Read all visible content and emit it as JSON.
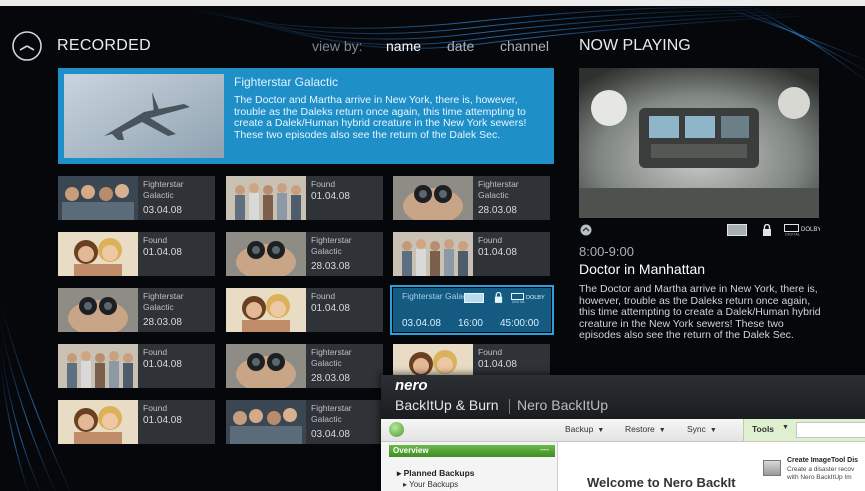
{
  "header": {
    "section_title": "RECORDED",
    "view_by_label": "view by:",
    "view_options": [
      "name",
      "date",
      "channel"
    ],
    "active_view": "name",
    "now_playing_title": "NOW PLAYING"
  },
  "featured": {
    "title": "Fighterstar Galactic",
    "description": "The Doctor and Martha arrive in New York, there is, however, trouble as the Daleks return once again, this time attempting to create a Dalek/Human hybrid creature in the New York sewers! These two episodes also see the return of the Dalek Sec."
  },
  "recordings": [
    {
      "title": "Fighterstar Galactic",
      "date": "03.04.08",
      "thumb": "crowd"
    },
    {
      "title": "Found",
      "date": "01.04.08",
      "thumb": "family"
    },
    {
      "title": "Fighterstar Galactic",
      "date": "28.03.08",
      "thumb": "binoculars"
    },
    {
      "title": "Found",
      "date": "01.04.08",
      "thumb": "couple"
    },
    {
      "title": "Fighterstar Galactic",
      "date": "28.03.08",
      "thumb": "binoculars"
    },
    {
      "title": "Found",
      "date": "01.04.08",
      "thumb": "family"
    },
    {
      "title": "Fighterstar Galactic",
      "date": "28.03.08",
      "thumb": "binoculars"
    },
    {
      "title": "Found",
      "date": "01.04.08",
      "thumb": "couple"
    },
    {
      "title": "Fighterstar Galactic",
      "date": "03.04.08",
      "time": "16:00",
      "duration": "45:00:00",
      "selected": true
    },
    {
      "title": "Found",
      "date": "01.04.08",
      "thumb": "family"
    },
    {
      "title": "Fighterstar Galactic",
      "date": "28.03.08",
      "thumb": "binoculars"
    },
    {
      "title": "Found",
      "date": "01.04.08",
      "thumb": "couple"
    },
    {
      "title": "Found",
      "date": "01.04.08",
      "thumb": "couple"
    },
    {
      "title": "Fighterstar Galactic",
      "date": "03.04.08",
      "thumb": "crowd"
    }
  ],
  "now_playing": {
    "time": "8:00-9:00",
    "show_title": "Doctor in Manhattan",
    "description": "The Doctor and Martha arrive in New York, there is, however, trouble as the Daleks return once again, this time attempting to create a Dalek/Human hybrid creature in the New York sewers! These two episodes also see the return of the Dalek Sec.",
    "icons": [
      "back-icon",
      "hd-icon",
      "lock-icon",
      "dolby-digital-icon"
    ]
  },
  "nero": {
    "logo": "nero",
    "product": "BackItUp & Burn",
    "subproduct": "Nero BackItUp",
    "toolbar": [
      "Backup",
      "Restore",
      "Sync"
    ],
    "tools_label": "Tools",
    "overview_label": "Overview",
    "planned_backups": "Planned Backups",
    "your_backups": "Your Backups",
    "welcome": "Welcome to Nero BackIt",
    "task_title": "Create ImageTool Dis",
    "task_desc": "Create a disaster recov with Nero BackItUp Im"
  },
  "colors": {
    "accent": "#1f8fc8",
    "tile_bg": "#2f3237",
    "background": "#05070b",
    "nero_green": "#4a9a2a"
  }
}
